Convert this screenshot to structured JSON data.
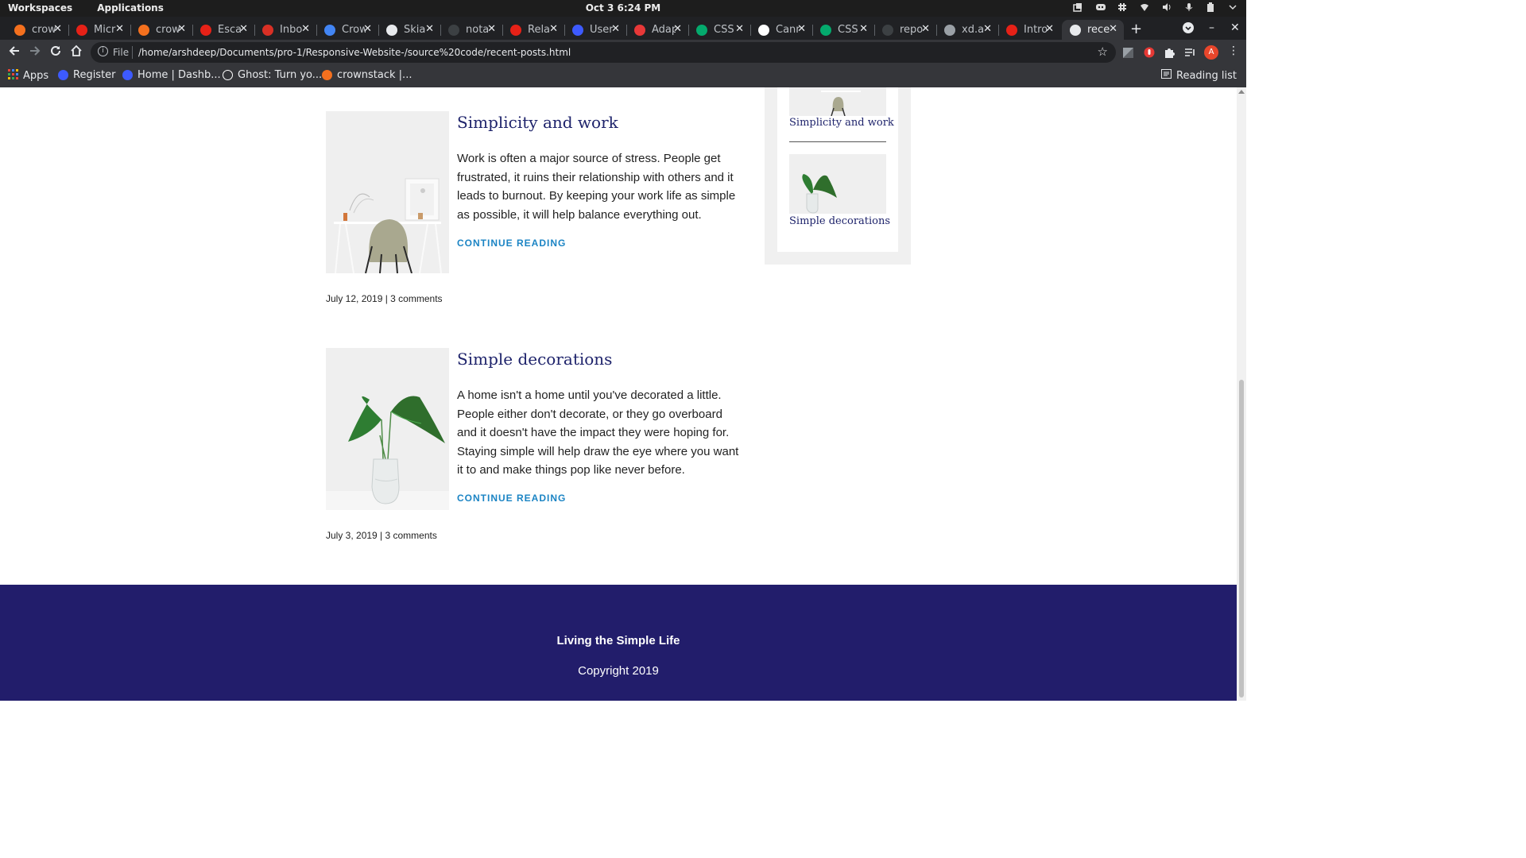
{
  "os": {
    "menus": [
      "Workspaces",
      "Applications"
    ],
    "clock": "Oct 3   6:24 PM"
  },
  "tabs": [
    {
      "label": "crow",
      "color": "#f4701e"
    },
    {
      "label": "Micr",
      "color": "#e62117"
    },
    {
      "label": "crow",
      "color": "#f4701e"
    },
    {
      "label": "Esca",
      "color": "#e62117"
    },
    {
      "label": "Inbo",
      "color": "#d93025"
    },
    {
      "label": "Crow",
      "color": "#4285f4"
    },
    {
      "label": "Skia",
      "color": "#e8eaed"
    },
    {
      "label": "nota",
      "color": "#3c4043"
    },
    {
      "label": "Rela",
      "color": "#e62117"
    },
    {
      "label": "User",
      "color": "#3d5afe"
    },
    {
      "label": "Adap",
      "color": "#e83838"
    },
    {
      "label": "CSS",
      "color": "#04aa6d"
    },
    {
      "label": "Cann",
      "color": "#ffffff"
    },
    {
      "label": "CSS",
      "color": "#04aa6d"
    },
    {
      "label": "repo",
      "color": "#3c4043"
    },
    {
      "label": "xd.a",
      "color": "#9aa0a6"
    },
    {
      "label": "Intro",
      "color": "#e62117"
    },
    {
      "label": "rece",
      "color": "#e8eaed"
    }
  ],
  "toolbar": {
    "scheme": "File",
    "url": "/home/arshdeep/Documents/pro-1/Responsive-Website-/source%20code/recent-posts.html",
    "profile_initial": "A"
  },
  "bookmarks": {
    "items": [
      {
        "label": "Apps",
        "color": "#ea4335"
      },
      {
        "label": "Register",
        "color": "#3d5afe"
      },
      {
        "label": "Home | Dashb...",
        "color": "#3d5afe"
      },
      {
        "label": "Ghost: Turn yo...",
        "color": "#ffffff"
      },
      {
        "label": "crownstack |...",
        "color": "#f4701e"
      }
    ],
    "reading_list": "Reading list"
  },
  "posts": [
    {
      "title": "Simplicity and work",
      "body": "Work is often a major source of stress. People get frustrated, it ruins their relationship with others and it leads to burnout. By keeping your work life as simple as possible, it will help balance everything out.",
      "cta": "CONTINUE READING",
      "meta": "July 12, 2019 | 3 comments"
    },
    {
      "title": "Simple decorations",
      "body": "A home isn't a home until you've decorated a little. People either don't decorate, or they go overboard and it doesn't have the impact they were hoping for. Staying simple will help draw the eye where you want it to and make things pop like never before.",
      "cta": "CONTINUE READING",
      "meta": "July 3, 2019 | 3 comments"
    }
  ],
  "sidebar": {
    "items": [
      {
        "label": "Simplicity and work"
      },
      {
        "label": "Simple decorations"
      }
    ]
  },
  "footer": {
    "title": "Living the Simple Life",
    "copyright": "Copyright 2019"
  }
}
